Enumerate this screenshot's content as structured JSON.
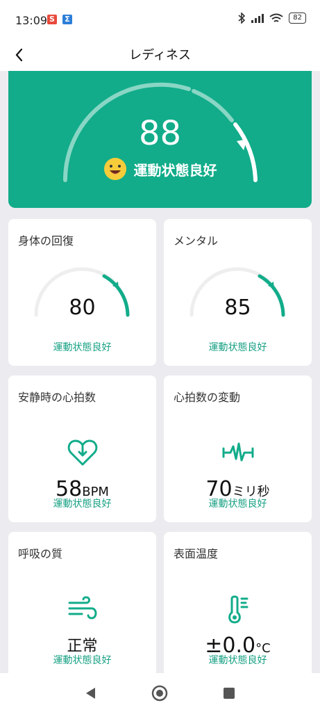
{
  "status_bar": {
    "time": "13:09",
    "app_badge_1": "S",
    "app_badge_2": "Σ",
    "battery": "82"
  },
  "header": {
    "title": "レディネス",
    "back_icon": "chevron-left-icon"
  },
  "hero": {
    "score": "88",
    "status": "運動状態良好",
    "accent": "#12ac8a"
  },
  "cards": [
    {
      "title": "身体の回復",
      "value": "80",
      "status": "運動状態良好"
    },
    {
      "title": "メンタル",
      "value": "85",
      "status": "運動状態良好"
    },
    {
      "title": "安静時の心拍数",
      "value": "58",
      "unit": "BPM",
      "status": "運動状態良好",
      "icon": "heart-down-icon"
    },
    {
      "title": "心拍数の変動",
      "value": "70",
      "unit": "ミリ秒",
      "status": "運動状態良好",
      "icon": "heartbeat-wave-icon"
    },
    {
      "title": "呼吸の質",
      "value": "正常",
      "status": "運動状態良好",
      "icon": "wind-icon"
    },
    {
      "title": "表面温度",
      "value": "±0.0",
      "unit": "°C",
      "status": "運動状態良好",
      "icon": "thermometer-icon"
    }
  ],
  "nav": {
    "back": "back-triangle-icon",
    "home": "home-circle-icon",
    "recents": "recents-square-icon"
  }
}
